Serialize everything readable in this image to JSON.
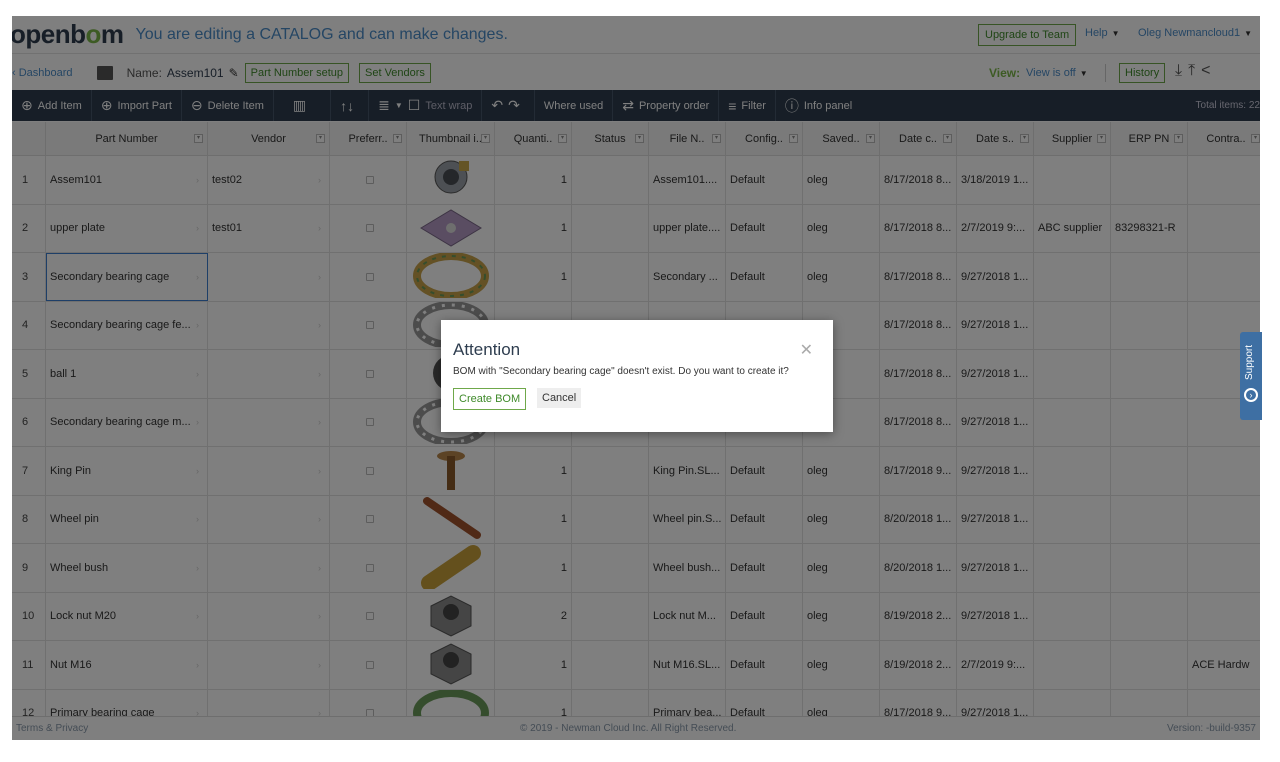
{
  "app": {
    "logo": "openbom",
    "banner": "You are editing a CATALOG and can make changes.",
    "upgrade_label": "Upgrade to Team",
    "help_label": "Help",
    "user_label": "Oleg Newmancloud1"
  },
  "subbar": {
    "dashboard_label": "Dashboard",
    "name_label": "Name:",
    "name_value": "Assem101",
    "part_number_setup": "Part Number setup",
    "set_vendors": "Set Vendors",
    "view_label": "View:",
    "view_value": "View is off",
    "history_label": "History"
  },
  "toolbar": {
    "add_item": "Add Item",
    "import_part": "Import Part",
    "delete_item": "Delete Item",
    "text_wrap": "Text wrap",
    "where_used": "Where used",
    "property_order": "Property order",
    "filter": "Filter",
    "info_panel": "Info panel",
    "total_items": "Total items: 22"
  },
  "columns": [
    "Part Number",
    "Vendor",
    "Preferr..",
    "Thumbnail i..",
    "Quanti..",
    "Status",
    "File N..",
    "Config..",
    "Saved..",
    "Date c..",
    "Date s..",
    "Supplier",
    "ERP PN",
    "Contra.."
  ],
  "rows": [
    {
      "idx": "1",
      "part": "Assem101",
      "vendor": "test02",
      "qty": "1",
      "file": "Assem101....",
      "config": "Default",
      "saved": "oleg",
      "date_c": "8/17/2018 8...",
      "date_s": "3/18/2019 1...",
      "supplier": "",
      "erp": "",
      "contra": "",
      "thumb": "assembly"
    },
    {
      "idx": "2",
      "part": "upper plate",
      "vendor": "test01",
      "qty": "1",
      "file": "upper plate....",
      "config": "Default",
      "saved": "oleg",
      "date_c": "8/17/2018 8...",
      "date_s": "2/7/2019 9:...",
      "supplier": "ABC supplier",
      "erp": "83298321-R",
      "contra": "",
      "thumb": "plate"
    },
    {
      "idx": "3",
      "part": "Secondary bearing cage",
      "vendor": "",
      "qty": "1",
      "file": "Secondary ...",
      "config": "Default",
      "saved": "oleg",
      "date_c": "8/17/2018 8...",
      "date_s": "9/27/2018 1...",
      "supplier": "",
      "erp": "",
      "contra": "",
      "thumb": "ring-gold"
    },
    {
      "idx": "4",
      "part": "Secondary bearing cage fe...",
      "vendor": "",
      "qty": "",
      "file": "",
      "config": "",
      "saved": "eg",
      "date_c": "8/17/2018 8...",
      "date_s": "9/27/2018 1...",
      "supplier": "",
      "erp": "",
      "contra": "",
      "thumb": "ring-grey"
    },
    {
      "idx": "5",
      "part": "ball 1",
      "vendor": "",
      "qty": "",
      "file": "",
      "config": "",
      "saved": "eg",
      "date_c": "8/17/2018 8...",
      "date_s": "9/27/2018 1...",
      "supplier": "",
      "erp": "",
      "contra": "",
      "thumb": "ball"
    },
    {
      "idx": "6",
      "part": "Secondary bearing cage m...",
      "vendor": "",
      "qty": "",
      "file": "",
      "config": "",
      "saved": "eg",
      "date_c": "8/17/2018 8...",
      "date_s": "9/27/2018 1...",
      "supplier": "",
      "erp": "",
      "contra": "",
      "thumb": "ring-grey"
    },
    {
      "idx": "7",
      "part": "King Pin",
      "vendor": "",
      "qty": "1",
      "file": "King Pin.SL...",
      "config": "Default",
      "saved": "oleg",
      "date_c": "8/17/2018 9...",
      "date_s": "9/27/2018 1...",
      "supplier": "",
      "erp": "",
      "contra": "",
      "thumb": "pin"
    },
    {
      "idx": "8",
      "part": "Wheel pin",
      "vendor": "",
      "qty": "1",
      "file": "Wheel pin.S...",
      "config": "Default",
      "saved": "oleg",
      "date_c": "8/20/2018 1...",
      "date_s": "9/27/2018 1...",
      "supplier": "",
      "erp": "",
      "contra": "",
      "thumb": "bolt"
    },
    {
      "idx": "9",
      "part": "Wheel bush",
      "vendor": "",
      "qty": "1",
      "file": "Wheel bush...",
      "config": "Default",
      "saved": "oleg",
      "date_c": "8/20/2018 1...",
      "date_s": "9/27/2018 1...",
      "supplier": "",
      "erp": "",
      "contra": "",
      "thumb": "bush"
    },
    {
      "idx": "10",
      "part": "Lock nut M20",
      "vendor": "",
      "qty": "2",
      "file": "Lock nut M...",
      "config": "Default",
      "saved": "oleg",
      "date_c": "8/19/2018 2...",
      "date_s": "9/27/2018 1...",
      "supplier": "",
      "erp": "",
      "contra": "",
      "thumb": "nut"
    },
    {
      "idx": "11",
      "part": "Nut M16",
      "vendor": "",
      "qty": "1",
      "file": "Nut M16.SL...",
      "config": "Default",
      "saved": "oleg",
      "date_c": "8/19/2018 2...",
      "date_s": "2/7/2019 9:...",
      "supplier": "",
      "erp": "",
      "contra": "ACE Hardw",
      "thumb": "nut"
    },
    {
      "idx": "12",
      "part": "Primary bearing cage",
      "vendor": "",
      "qty": "1",
      "file": "Primary bea...",
      "config": "Default",
      "saved": "oleg",
      "date_c": "8/17/2018 9...",
      "date_s": "9/27/2018 1...",
      "supplier": "",
      "erp": "",
      "contra": "",
      "thumb": "ring-green"
    }
  ],
  "footer": {
    "terms": "Terms & Privacy",
    "copyright": "© 2019 - Newman Cloud Inc. All Right Reserved.",
    "version": "Version: -build-9357"
  },
  "dialog": {
    "title": "Attention",
    "message": "BOM with \"Secondary bearing cage\" doesn't exist. Do you want to create it?",
    "create_label": "Create BOM",
    "cancel_label": "Cancel"
  },
  "support_label": "Support"
}
